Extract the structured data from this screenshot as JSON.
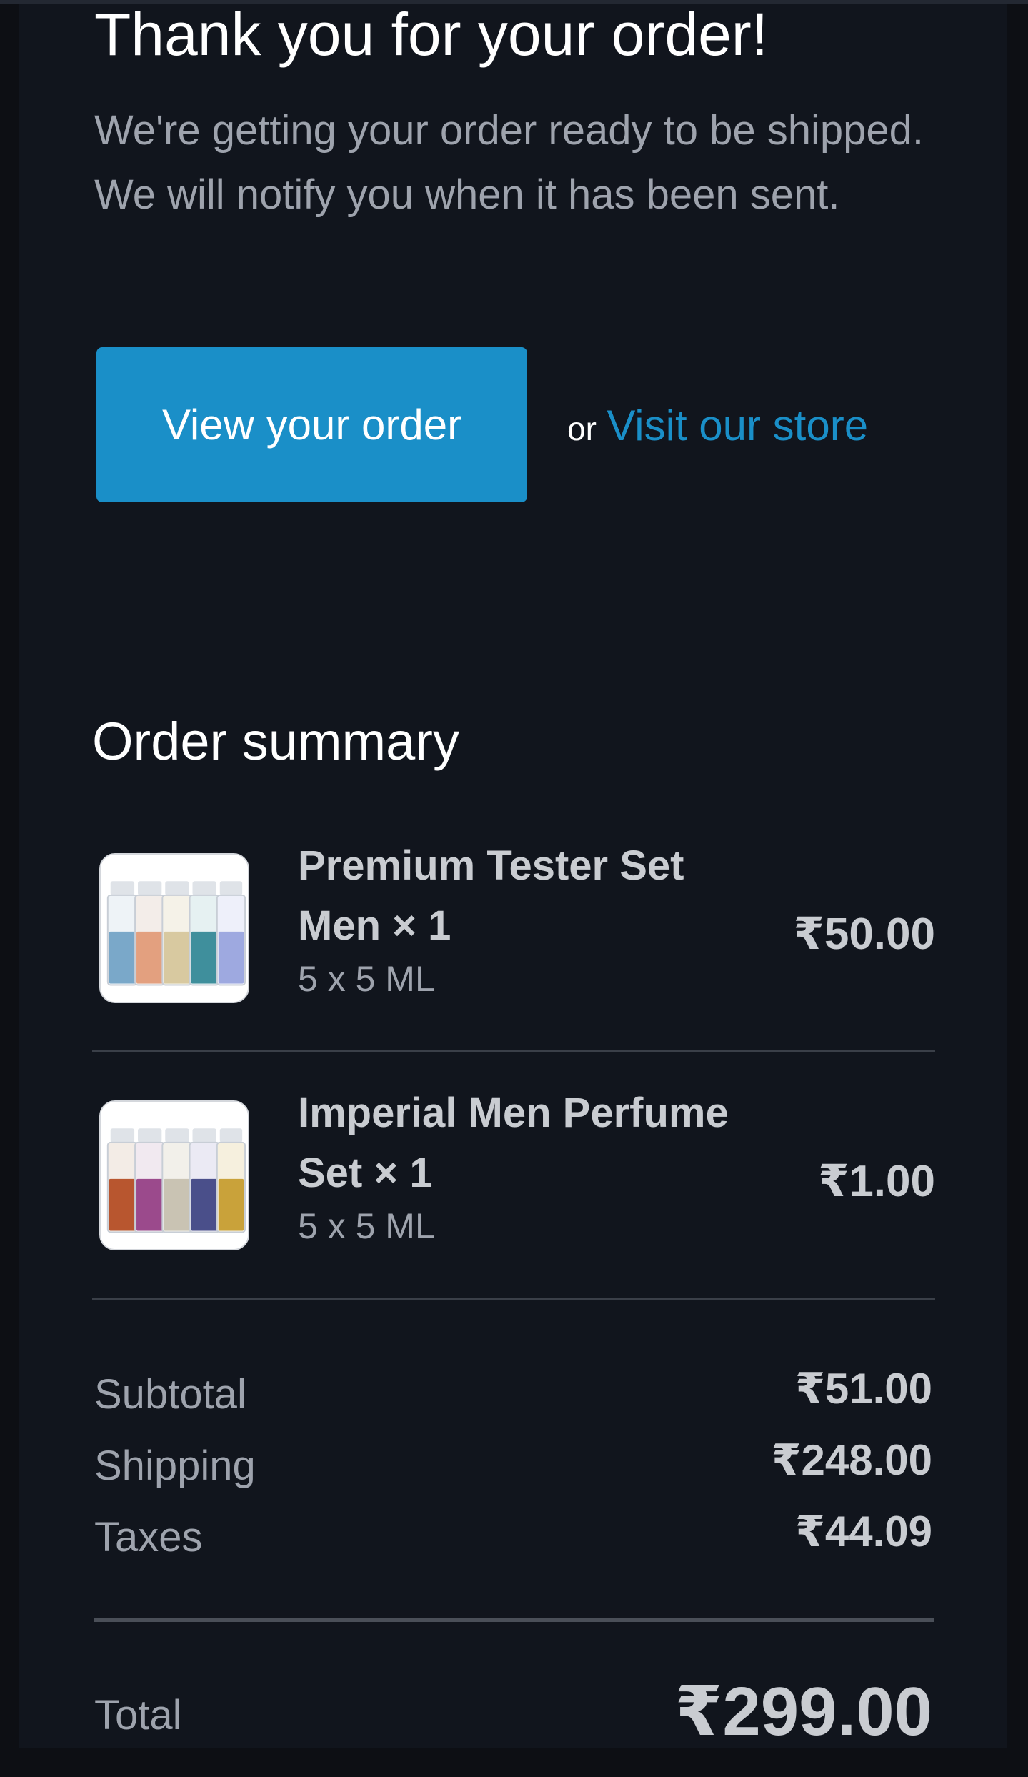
{
  "header": {
    "title": "Thank you for your order!",
    "subtitle": "We're getting your order ready to be shipped. We will notify you when it has been sent."
  },
  "actions": {
    "view_order_label": "View your order",
    "or_text": "or",
    "store_link_label": "Visit our store"
  },
  "colors": {
    "accent": "#1a8fc8",
    "background": "#11151d"
  },
  "order_summary": {
    "title": "Order summary",
    "items": [
      {
        "name": "Premium Tester Set Men × 1",
        "variant": "5 x 5 ML",
        "price": "₹50.00",
        "image_icon": "perfume-tester-set-image"
      },
      {
        "name": "Imperial Men Perfume Set × 1",
        "variant": "5 x 5 ML",
        "price": "₹1.00",
        "image_icon": "perfume-set-image"
      }
    ],
    "subtotal_label": "Subtotal",
    "subtotal_value": "₹51.00",
    "shipping_label": "Shipping",
    "shipping_value": "₹248.00",
    "taxes_label": "Taxes",
    "taxes_value": "₹44.09",
    "total_label": "Total",
    "total_value": "₹299.00"
  }
}
